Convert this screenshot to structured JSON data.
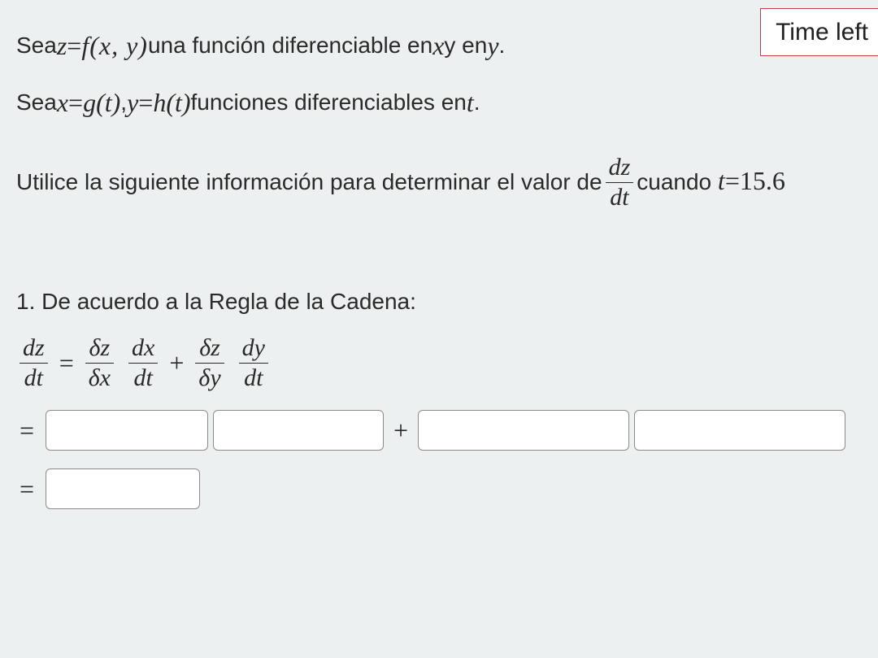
{
  "timer": {
    "label": "Time left"
  },
  "intro": {
    "line1_a": "Sea ",
    "line1_expr_z": "z",
    "line1_eq": " = ",
    "line1_fxy": "f(x, y)",
    "line1_b": " una función diferenciable en ",
    "line1_x": "x",
    "line1_c": " y en ",
    "line1_y": "y",
    "line1_d": ".",
    "line2_a": "Sea ",
    "line2_x": "x",
    "line2_eq1": " = ",
    "line2_gt": "g(t)",
    "line2_comma": ", ",
    "line2_y": "y",
    "line2_eq2": " = ",
    "line2_ht": "h(t)",
    "line2_b": " funciones diferenciables en ",
    "line2_t": "t",
    "line2_c": ".",
    "line3_a": "Utilice la siguiente información para determinar el valor de ",
    "line3_frac_num": "dz",
    "line3_frac_den": "dt",
    "line3_b": " cuando",
    "line4_t": "t",
    "line4_eq": " = ",
    "line4_val": "15.6"
  },
  "chain": {
    "title": "1. De acuerdo a la Regla de la Cadena:",
    "lhs_num": "dz",
    "lhs_den": "dt",
    "eq": "=",
    "t1a_num": "δz",
    "t1a_den": "δx",
    "t1b_num": "dx",
    "t1b_den": "dt",
    "plus": "+",
    "t2a_num": "δz",
    "t2a_den": "δy",
    "t2b_num": "dy",
    "t2b_den": "dt"
  },
  "answers": {
    "eq": "=",
    "plus": "+"
  }
}
